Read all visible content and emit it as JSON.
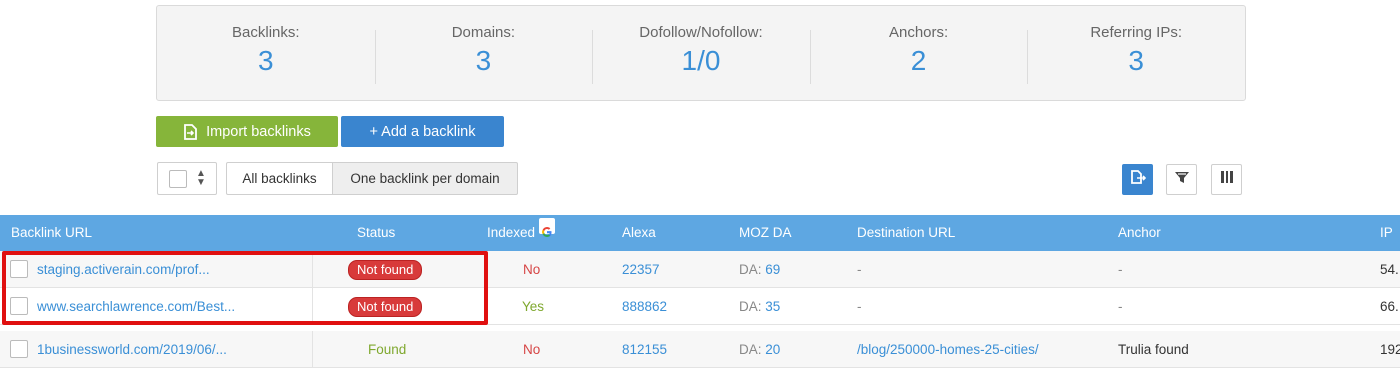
{
  "stats": [
    {
      "label": "Backlinks:",
      "value": "3"
    },
    {
      "label": "Domains:",
      "value": "3"
    },
    {
      "label": "Dofollow/Nofollow:",
      "value": "1/0"
    },
    {
      "label": "Anchors:",
      "value": "2"
    },
    {
      "label": "Referring IPs:",
      "value": "3"
    }
  ],
  "actions": {
    "import_label": "Import backlinks",
    "add_label": "+ Add a backlink"
  },
  "filters": {
    "all_label": "All backlinks",
    "one_per_domain_label": "One backlink per domain",
    "active": "One backlink per domain"
  },
  "toolbar_icons": [
    "export-icon",
    "filter-icon",
    "columns-icon"
  ],
  "table": {
    "headers": {
      "backlink_url": "Backlink URL",
      "status": "Status",
      "indexed": "Indexed",
      "alexa": "Alexa",
      "moz_da": "MOZ DA",
      "destination_url": "Destination URL",
      "anchor": "Anchor",
      "ip": "IP"
    },
    "rows": [
      {
        "url": "staging.activerain.com/prof...",
        "status": "Not found",
        "indexed": "No",
        "alexa": "22357",
        "da_label": "DA: ",
        "da": "69",
        "destination": "-",
        "anchor": "-",
        "ip": "54."
      },
      {
        "url": "www.searchlawrence.com/Best...",
        "status": "Not found",
        "indexed": "Yes",
        "alexa": "888862",
        "da_label": "DA: ",
        "da": "35",
        "destination": "-",
        "anchor": "-",
        "ip": "66."
      },
      {
        "url": "1businessworld.com/2019/06/...",
        "status": "Found",
        "indexed": "No",
        "alexa": "812155",
        "da_label": "DA: ",
        "da": "20",
        "destination": "/blog/250000-homes-25-cities/",
        "anchor": "Trulia found",
        "ip": "192"
      }
    ]
  },
  "colors": {
    "accent_blue": "#3a85cf",
    "header_blue": "#5ea7e2",
    "import_green": "#86b53a",
    "not_found_red": "#d83a3a",
    "highlight_red": "#e01010"
  }
}
